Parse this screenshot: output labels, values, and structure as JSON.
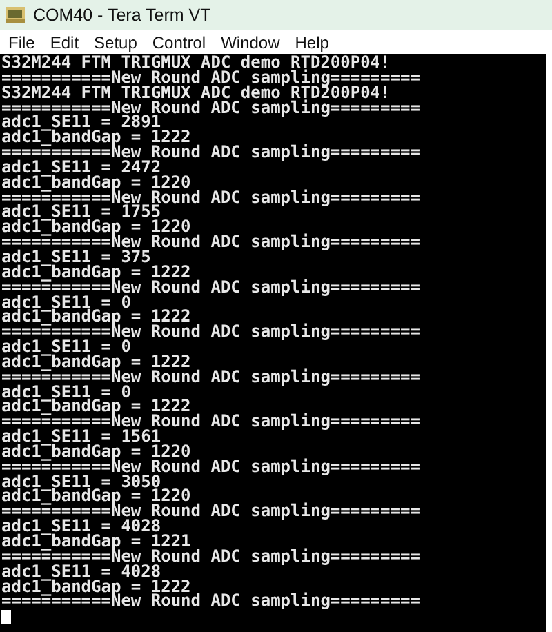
{
  "window": {
    "title": "COM40 - Tera Term VT"
  },
  "menu": [
    "File",
    "Edit",
    "Setup",
    "Control",
    "Window",
    "Help"
  ],
  "terminal": {
    "lines": [
      "S32M244 FTM TRIGMUX ADC demo RTD200P04!",
      "===========New Round ADC sampling=========",
      "S32M244 FTM TRIGMUX ADC demo RTD200P04!",
      "===========New Round ADC sampling=========",
      "adc1_SE11 = 2891",
      "adc1_bandGap = 1222",
      "===========New Round ADC sampling=========",
      "adc1_SE11 = 2472",
      "adc1_bandGap = 1220",
      "===========New Round ADC sampling=========",
      "adc1_SE11 = 1755",
      "adc1_bandGap = 1220",
      "===========New Round ADC sampling=========",
      "adc1_SE11 = 375",
      "adc1_bandGap = 1222",
      "===========New Round ADC sampling=========",
      "adc1_SE11 = 0",
      "adc1_bandGap = 1222",
      "===========New Round ADC sampling=========",
      "adc1_SE11 = 0",
      "adc1_bandGap = 1222",
      "===========New Round ADC sampling=========",
      "adc1_SE11 = 0",
      "adc1_bandGap = 1222",
      "===========New Round ADC sampling=========",
      "adc1_SE11 = 1561",
      "adc1_bandGap = 1220",
      "===========New Round ADC sampling=========",
      "adc1_SE11 = 3050",
      "adc1_bandGap = 1220",
      "===========New Round ADC sampling=========",
      "adc1_SE11 = 4028",
      "adc1_bandGap = 1221",
      "===========New Round ADC sampling=========",
      "adc1_SE11 = 4028",
      "adc1_bandGap = 1222",
      "===========New Round ADC sampling========="
    ]
  }
}
